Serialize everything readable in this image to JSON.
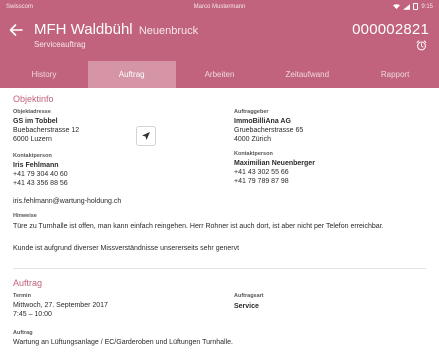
{
  "status_bar": {
    "carrier": "Swisscom",
    "user": "Marco Mustermann",
    "time": "9:15"
  },
  "header": {
    "title": "MFH Waldbühl",
    "location": "Neuenbruck",
    "subtitle": "Serviceauftrag",
    "order_number": "000002821"
  },
  "tabs": [
    {
      "label": "History",
      "active": false
    },
    {
      "label": "Auftrag",
      "active": true
    },
    {
      "label": "Arbeiten",
      "active": false
    },
    {
      "label": "Zeitaufwand",
      "active": false
    },
    {
      "label": "Rapport",
      "active": false
    }
  ],
  "objektinfo": {
    "section_title": "Objektinfo",
    "objektadresse": {
      "label": "Objektadresse",
      "lines": [
        "GS im Tobbel",
        "Buebacherstrasse 12",
        "6000 Luzern"
      ]
    },
    "auftraggeber": {
      "label": "Auftraggeber",
      "lines": [
        "ImmoBilliAna AG",
        "Gruebacherstrasse 65",
        "4000 Zürich"
      ]
    },
    "kontaktperson_left": {
      "label": "Kontaktperson",
      "lines": [
        "Iris Fehlmann",
        "+41 79 304 40 60",
        "+41 43 356 88 56"
      ]
    },
    "kontaktperson_right": {
      "label": "Kontaktperson",
      "lines": [
        "Maximilian Neuenberger",
        "+41 43 302 55 66",
        "+41 79 789 87 98"
      ]
    },
    "email": "iris.fehlmann@wartung-holdung.ch",
    "hinweise": {
      "label": "Hinweise",
      "text": "Türe zu Turnhalle ist offen, man kann einfach reingehen. Herr Rohner ist auch dort, ist aber nicht per Telefon erreichbar.",
      "text2": "Kunde ist aufgrund diverser Missverständnisse unsererseits sehr genervt"
    }
  },
  "auftrag": {
    "section_title": "Auftrag",
    "termin": {
      "label": "Termin",
      "date": "Mittwoch, 27. September 2017",
      "time": "7:45 – 10:00"
    },
    "auftragsart": {
      "label": "Auftragsart",
      "value": "Service"
    },
    "auftrag": {
      "label": "Auftrag",
      "value": "Wartung an Lüftungsanlage / EC/Garderoben und Lüftungen Turnhalle."
    }
  },
  "colors": {
    "brand": "#c1637c",
    "header_text": "#ffffff"
  }
}
